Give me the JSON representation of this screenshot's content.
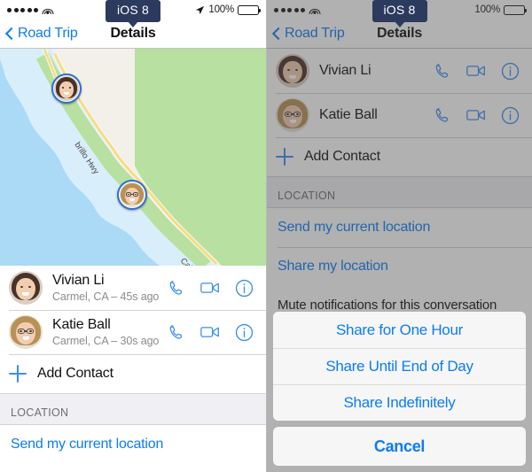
{
  "left": {
    "status": {
      "signal_dots": 5,
      "wifi_icon": "wifi-icon",
      "location_icon": "location-arrow-icon",
      "battery_percent": "100%",
      "battery_icon": "battery-full-icon"
    },
    "badge": {
      "label": "iOS 8"
    },
    "nav": {
      "back_label": "Road Trip",
      "back_icon": "chevron-left-icon",
      "title": "Details"
    },
    "map": {
      "road_label_1": "brillo Hwy",
      "road_label_2": "Cabrill",
      "pins": [
        {
          "person": "Vivian Li",
          "avatar": "av-vivian"
        },
        {
          "person": "Katie Ball",
          "avatar": "av-katie"
        }
      ]
    },
    "contacts": [
      {
        "name": "Vivian Li",
        "subtitle": "Carmel, CA – 45s ago",
        "avatar": "av-vivian",
        "call_icon": "phone-icon",
        "video_icon": "video-camera-icon",
        "info_icon": "info-circle-icon"
      },
      {
        "name": "Katie Ball",
        "subtitle": "Carmel, CA – 30s ago",
        "avatar": "av-katie",
        "call_icon": "phone-icon",
        "video_icon": "video-camera-icon",
        "info_icon": "info-circle-icon"
      }
    ],
    "add_contact": {
      "label": "Add Contact",
      "icon": "plus-icon"
    },
    "section_location": "LOCATION",
    "location_links": [
      "Send my current location"
    ]
  },
  "right": {
    "status": {
      "signal_dots": 5,
      "wifi_icon": "wifi-icon",
      "battery_percent": "100%",
      "battery_icon": "battery-full-icon"
    },
    "badge": {
      "label": "iOS 8"
    },
    "nav": {
      "back_label": "Road Trip",
      "back_icon": "chevron-left-icon",
      "title": "Details"
    },
    "contacts": [
      {
        "name": "Vivian Li",
        "avatar": "av-vivian",
        "call_icon": "phone-icon",
        "video_icon": "video-camera-icon",
        "info_icon": "info-circle-icon"
      },
      {
        "name": "Katie Ball",
        "avatar": "av-katie",
        "call_icon": "phone-icon",
        "video_icon": "video-camera-icon",
        "info_icon": "info-circle-icon"
      }
    ],
    "add_contact": {
      "label": "Add Contact",
      "icon": "plus-icon"
    },
    "section_location": "LOCATION",
    "location_links": [
      "Send my current location",
      "Share my location"
    ],
    "mute_row": "Mute notifications for this conversation",
    "action_sheet": {
      "options": [
        "Share for One Hour",
        "Share Until End of Day",
        "Share Indefinitely"
      ],
      "cancel_label": "Cancel"
    }
  },
  "colors": {
    "accent_blue": "#0c7cf4",
    "icon_blue": "#3a8ef0",
    "badge_navy": "#2c3a5e",
    "section_gray": "#efeff4",
    "map_water": "#aadaf6",
    "map_land": "#f3efe9",
    "map_green": "#b8e0a0",
    "map_road": "#f5dd8c"
  }
}
